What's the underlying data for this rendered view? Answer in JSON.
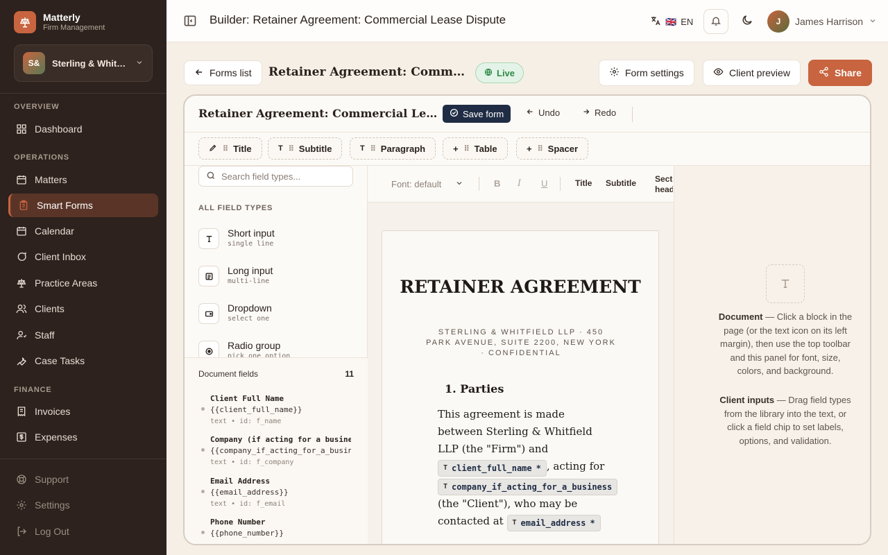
{
  "sidebar": {
    "brand_name": "Matterly",
    "brand_sub": "Firm Management",
    "firm_initials": "S&",
    "firm_name": "Sterling & Whitfield LLP",
    "sections": {
      "overview": "OVERVIEW",
      "operations": "OPERATIONS",
      "finance": "FINANCE"
    },
    "items": {
      "dashboard": "Dashboard",
      "matters": "Matters",
      "smart_forms": "Smart Forms",
      "calendar": "Calendar",
      "client_inbox": "Client Inbox",
      "practice_areas": "Practice Areas",
      "clients": "Clients",
      "staff": "Staff",
      "case_tasks": "Case Tasks",
      "invoices": "Invoices",
      "expenses": "Expenses",
      "support": "Support",
      "settings": "Settings",
      "log_out": "Log Out"
    }
  },
  "topbar": {
    "title": "Builder: Retainer Agreement: Commercial Lease Dispute",
    "language": "EN",
    "flag": "🇬🇧",
    "user_initial": "J",
    "user_name": "James Harrison"
  },
  "header": {
    "back_label": "Forms list",
    "form_name": "Retainer Agreement: Commercial Lease Dispute",
    "status": "Live",
    "form_settings": "Form settings",
    "client_preview": "Client preview",
    "share": "Share"
  },
  "builder": {
    "title": "Retainer Agreement: Commercial Lease Dispute",
    "save": "Save form",
    "undo": "Undo",
    "redo": "Redo",
    "blocks": [
      {
        "label": "Title",
        "icon": "pen-icon"
      },
      {
        "label": "Subtitle",
        "icon": "text-icon"
      },
      {
        "label": "Paragraph",
        "icon": "text-icon"
      },
      {
        "label": "Table",
        "icon": "plus-icon"
      },
      {
        "label": "Spacer",
        "icon": "plus-icon"
      }
    ]
  },
  "library": {
    "search_placeholder": "Search field types...",
    "heading": "ALL FIELD TYPES",
    "field_types": [
      {
        "name": "Short input",
        "sub": "single line"
      },
      {
        "name": "Long input",
        "sub": "multi-line"
      },
      {
        "name": "Dropdown",
        "sub": "select one"
      },
      {
        "name": "Radio group",
        "sub": "pick one option"
      }
    ],
    "doc_fields_label": "Document fields",
    "doc_fields_count": "11",
    "doc_fields": [
      {
        "name": "Client Full Name",
        "key": "{{client_full_name}}",
        "meta": "text • id: f_name"
      },
      {
        "name": "Company (if acting for a business)",
        "key": "{{company_if_acting_for_a_business}}",
        "meta": "text • id: f_company"
      },
      {
        "name": "Email Address",
        "key": "{{email_address}}",
        "meta": "text • id: f_email"
      },
      {
        "name": "Phone Number",
        "key": "{{phone_number}}",
        "meta": ""
      }
    ]
  },
  "format_bar": {
    "font": "Font: default",
    "bold": "B",
    "italic": "I",
    "underline": "U",
    "title": "Title",
    "subtitle": "Subtitle",
    "section_heading": "Section heading"
  },
  "document": {
    "title": "RETAINER AGREEMENT",
    "subtitle": "STERLING & WHITFIELD LLP · 450 PARK AVENUE, SUITE 2200, NEW YORK · CONFIDENTIAL",
    "section_heading": "1. Parties",
    "p1": "This agreement is made between Sterling & Whitfield LLP (the \"Firm\") and",
    "chip_client": "client_full_name",
    "p2": ", acting for",
    "chip_company": "company_if_acting_for_a_business",
    "p3": "(the \"Client\"), who may be contacted at",
    "chip_email": "email_address",
    "required_mark": "*"
  },
  "props": {
    "doc_bold": "Document",
    "doc_text": " — Click a block in the page (or the text icon on its left margin), then use the top toolbar and this panel for font, size, colors, and background.",
    "inputs_bold": "Client inputs",
    "inputs_text": " — Drag field types from the library into the text, or click a field chip to set labels, options, and validation."
  },
  "colors": {
    "sidebar_bg": "#2d221d",
    "accent": "#c8643f",
    "live_green": "#2f8a49",
    "save_navy": "#1f2c44"
  }
}
